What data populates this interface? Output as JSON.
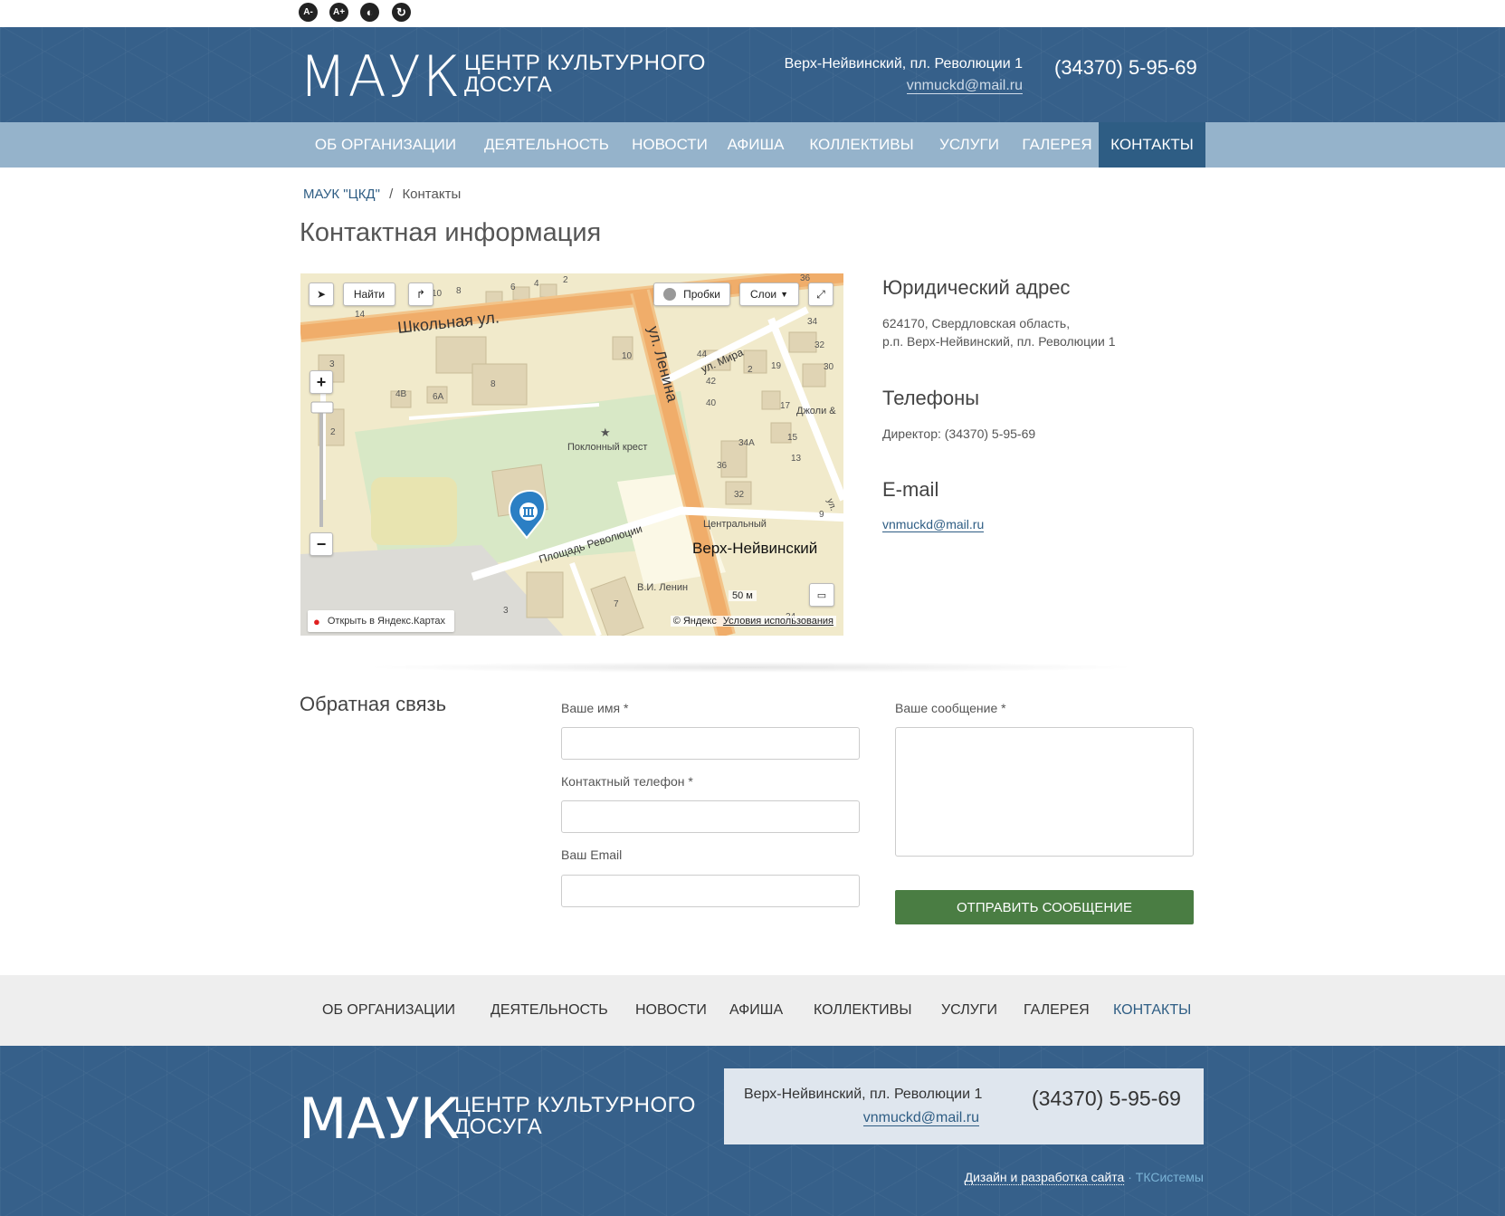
{
  "accessibility": [
    {
      "label": "A-"
    },
    {
      "label": "A+"
    },
    {
      "label": "◐"
    },
    {
      "label": "↻"
    }
  ],
  "header": {
    "logo_main": "МАУК",
    "logo_sub": "ЦЕНТР КУЛЬТУРНОГО ДОСУГА",
    "address": "Верх-Нейвинский, пл. Революции 1",
    "email": "vnmuckd@mail.ru",
    "phone": "(34370) 5-95-69"
  },
  "nav": {
    "items": [
      {
        "label": "ОБ ОРГАНИЗАЦИИ"
      },
      {
        "label": "ДЕЯТЕЛЬНОСТЬ"
      },
      {
        "label": "НОВОСТИ"
      },
      {
        "label": "АФИША"
      },
      {
        "label": "КОЛЛЕКТИВЫ"
      },
      {
        "label": "УСЛУГИ"
      },
      {
        "label": "ГАЛЕРЕЯ"
      },
      {
        "label": "КОНТАКТЫ"
      }
    ],
    "active": "КОНТАКТЫ"
  },
  "breadcrumb": {
    "home": "МАУК \"ЦКД\"",
    "separator": "/",
    "current": "Контакты"
  },
  "page_title": "Контактная информация",
  "map": {
    "find_label": "Найти",
    "traffic_label": "Пробки",
    "layers_label": "Слои",
    "open_label": "Открыть в Яндекс.Картах",
    "copyright": "© Яндекс",
    "terms": "Условия использования",
    "scale": "50 м",
    "streets": {
      "shkolnaya": "Школьная ул.",
      "lenina": "ул. Ленина",
      "mira": "ул. Мира",
      "revolution_sq": "Площадь Революции",
      "town": "Верх-Нейвинский",
      "cross": "Поклонный крест",
      "central": "Центральный",
      "lenin_monument": "В.И. Ленин",
      "jolly": "Джоли &",
      "edge_label": "ул."
    },
    "houses": [
      "10",
      "8",
      "6",
      "4",
      "2",
      "36",
      "14",
      "34",
      "32",
      "30",
      "3",
      "10",
      "44",
      "42",
      "40",
      "19",
      "2",
      "8",
      "4В",
      "6А",
      "17",
      "15",
      "13",
      "34А",
      "36",
      "2",
      "32",
      "9",
      "3",
      "7",
      "24"
    ]
  },
  "legal": {
    "title": "Юридический адрес",
    "line1": "624170, Свердловская область,",
    "line2": "р.п. Верх-Нейвинский, пл. Революции 1"
  },
  "phones": {
    "title": "Телефоны",
    "director": "Директор: (34370) 5-95-69"
  },
  "email_section": {
    "title": "E-mail",
    "email": "vnmuckd@mail.ru"
  },
  "feedback": {
    "title": "Обратная связь",
    "name_label": "Ваше имя *",
    "phone_label": "Контактный телефон *",
    "email_label": "Ваш Email",
    "message_label": "Ваше сообщение *",
    "submit": "ОТПРАВИТЬ СООБЩЕНИЕ"
  },
  "footer_nav": {
    "items": [
      {
        "label": "ОБ ОРГАНИЗАЦИИ"
      },
      {
        "label": "ДЕЯТЕЛЬНОСТЬ"
      },
      {
        "label": "НОВОСТИ"
      },
      {
        "label": "АФИША"
      },
      {
        "label": "КОЛЛЕКТИВЫ"
      },
      {
        "label": "УСЛУГИ"
      },
      {
        "label": "ГАЛЕРЕЯ"
      },
      {
        "label": "КОНТАКТЫ"
      }
    ],
    "active": "КОНТАКТЫ"
  },
  "footer": {
    "logo_main": "МАУК",
    "logo_sub": "ЦЕНТР КУЛЬТУРНОГО ДОСУГА",
    "address": "Верх-Нейвинский, пл. Революции 1",
    "email": "vnmuckd@mail.ru",
    "phone": "(34370) 5-95-69",
    "dev_label": "Дизайн и разработка сайта",
    "dev_sep": " · ",
    "dev_company": "ТКСистемы"
  },
  "colors": {
    "header_blue": "#36608a",
    "nav_light": "#95b3cb",
    "nav_active": "#2e5d84",
    "button_green": "#4a7d43"
  }
}
